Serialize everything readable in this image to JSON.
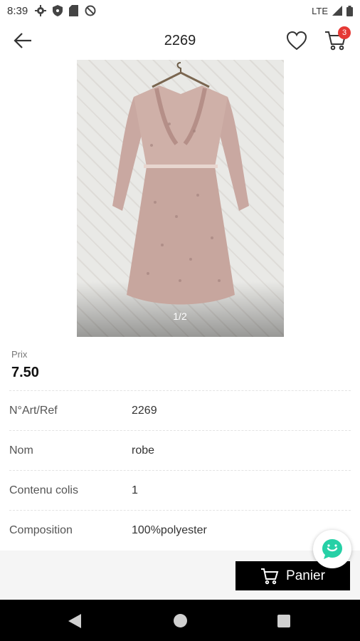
{
  "status_bar": {
    "time": "8:39",
    "network": "LTE"
  },
  "app_bar": {
    "title": "2269",
    "cart_count": "3"
  },
  "gallery": {
    "counter": "1/2"
  },
  "price": {
    "label": "Prix",
    "value": "7.50"
  },
  "details": [
    {
      "key": "N°Art/Ref",
      "value": "2269"
    },
    {
      "key": "Nom",
      "value": "robe"
    },
    {
      "key": "Contenu colis",
      "value": "1"
    },
    {
      "key": "Composition",
      "value": "100%polyester"
    }
  ],
  "actions": {
    "cart_button": "Panier"
  },
  "colors": {
    "accent": "#000000",
    "badge": "#e53935",
    "chat": "#26d0a6"
  }
}
